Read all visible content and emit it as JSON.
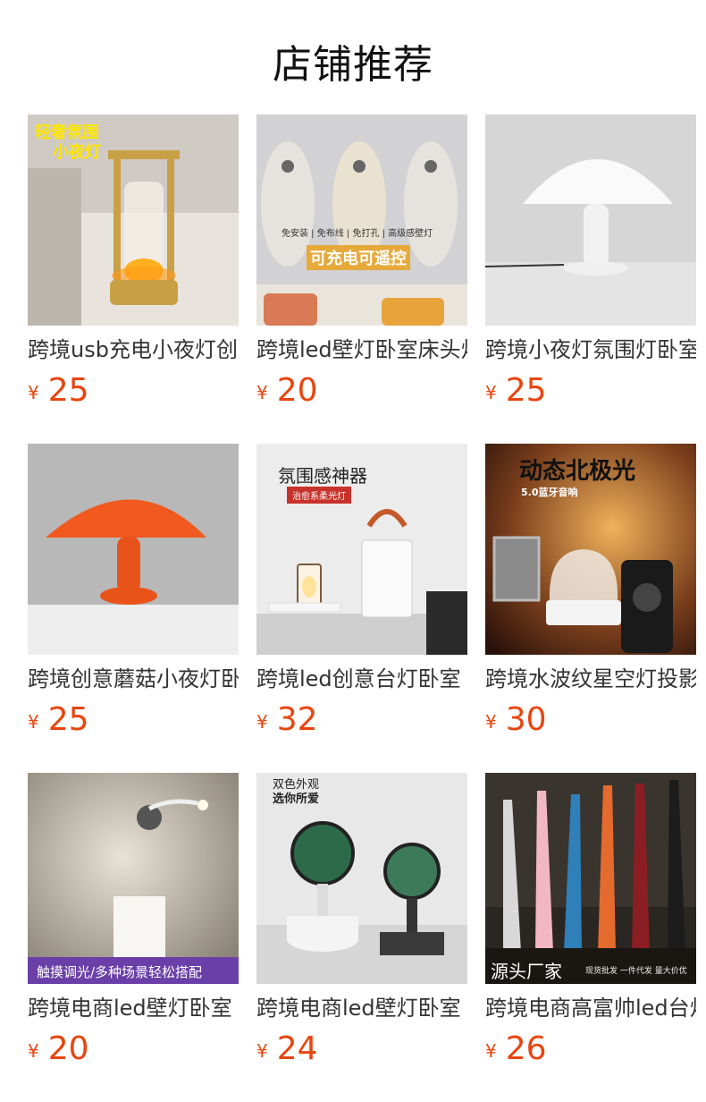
{
  "page": {
    "title": "店铺推荐"
  },
  "products": [
    {
      "name": "跨境usb充电小夜灯创意",
      "currency": "¥",
      "price": "25",
      "image_text": [
        "轻奢氛围",
        "小夜灯"
      ]
    },
    {
      "name": "跨境led壁灯卧室床头灯",
      "currency": "¥",
      "price": "20",
      "image_text": [
        "免安装 | 免布线 | 免打孔 | 高级感壁灯",
        "可充电可遥控"
      ]
    },
    {
      "name": "跨境小夜灯氛围灯卧室",
      "currency": "¥",
      "price": "25",
      "image_text": []
    },
    {
      "name": "跨境创意蘑菇小夜灯卧",
      "currency": "¥",
      "price": "25",
      "image_text": []
    },
    {
      "name": "跨境led创意台灯卧室",
      "currency": "¥",
      "price": "32",
      "image_text": [
        "氛围感神器",
        "治愈系柔光灯"
      ]
    },
    {
      "name": "跨境水波纹星空灯投影",
      "currency": "¥",
      "price": "30",
      "image_text": [
        "动态北极光",
        "5.0蓝牙音响"
      ]
    },
    {
      "name": "跨境电商led壁灯卧室",
      "currency": "¥",
      "price": "20",
      "image_text": [
        "触摸调光/多种场景轻松搭配"
      ]
    },
    {
      "name": "跨境电商led壁灯卧室",
      "currency": "¥",
      "price": "24",
      "image_text": [
        "双色外观",
        "选你所爱"
      ]
    },
    {
      "name": "跨境电商高富帅led台灯",
      "currency": "¥",
      "price": "26",
      "image_text": [
        "源头厂家",
        "现货批发 一件代发 量大价优"
      ]
    }
  ],
  "colors": {
    "price": "#e8450f",
    "title": "#111111",
    "name": "#333333"
  }
}
